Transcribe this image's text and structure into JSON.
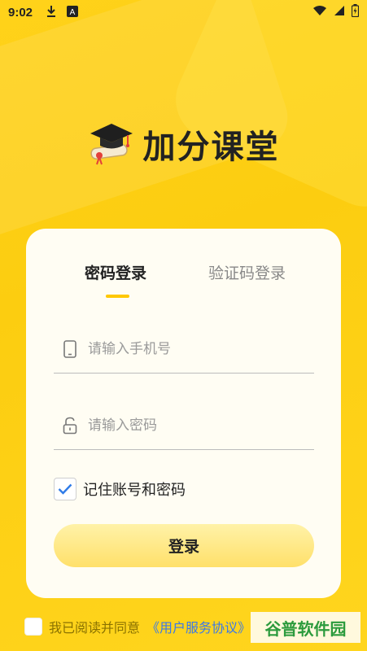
{
  "status_bar": {
    "time": "9:02",
    "icons_left": [
      "download-icon",
      "font-a-icon"
    ],
    "icons_right": [
      "wifi-icon",
      "signal-icon",
      "battery-icon"
    ]
  },
  "brand": {
    "title": "加分课堂",
    "logo_icon": "graduation-cap-diploma-icon"
  },
  "login_card": {
    "tabs": [
      {
        "label": "密码登录",
        "active": true
      },
      {
        "label": "验证码登录",
        "active": false
      }
    ],
    "phone_field": {
      "placeholder": "请输入手机号",
      "value": "",
      "icon": "phone-icon"
    },
    "password_field": {
      "placeholder": "请输入密码",
      "value": "",
      "icon": "lock-icon"
    },
    "remember": {
      "label": "记住账号和密码",
      "checked": true
    },
    "login_button": "登录"
  },
  "agreement": {
    "text": "我已阅读并同意",
    "link": "《用户服务协议》",
    "checked": false
  },
  "watermark": "谷普软件园",
  "colors": {
    "background": "#ffd21a",
    "accent": "#ffc800",
    "card": "#fffdf3",
    "checkbox_check": "#2f7be8"
  }
}
